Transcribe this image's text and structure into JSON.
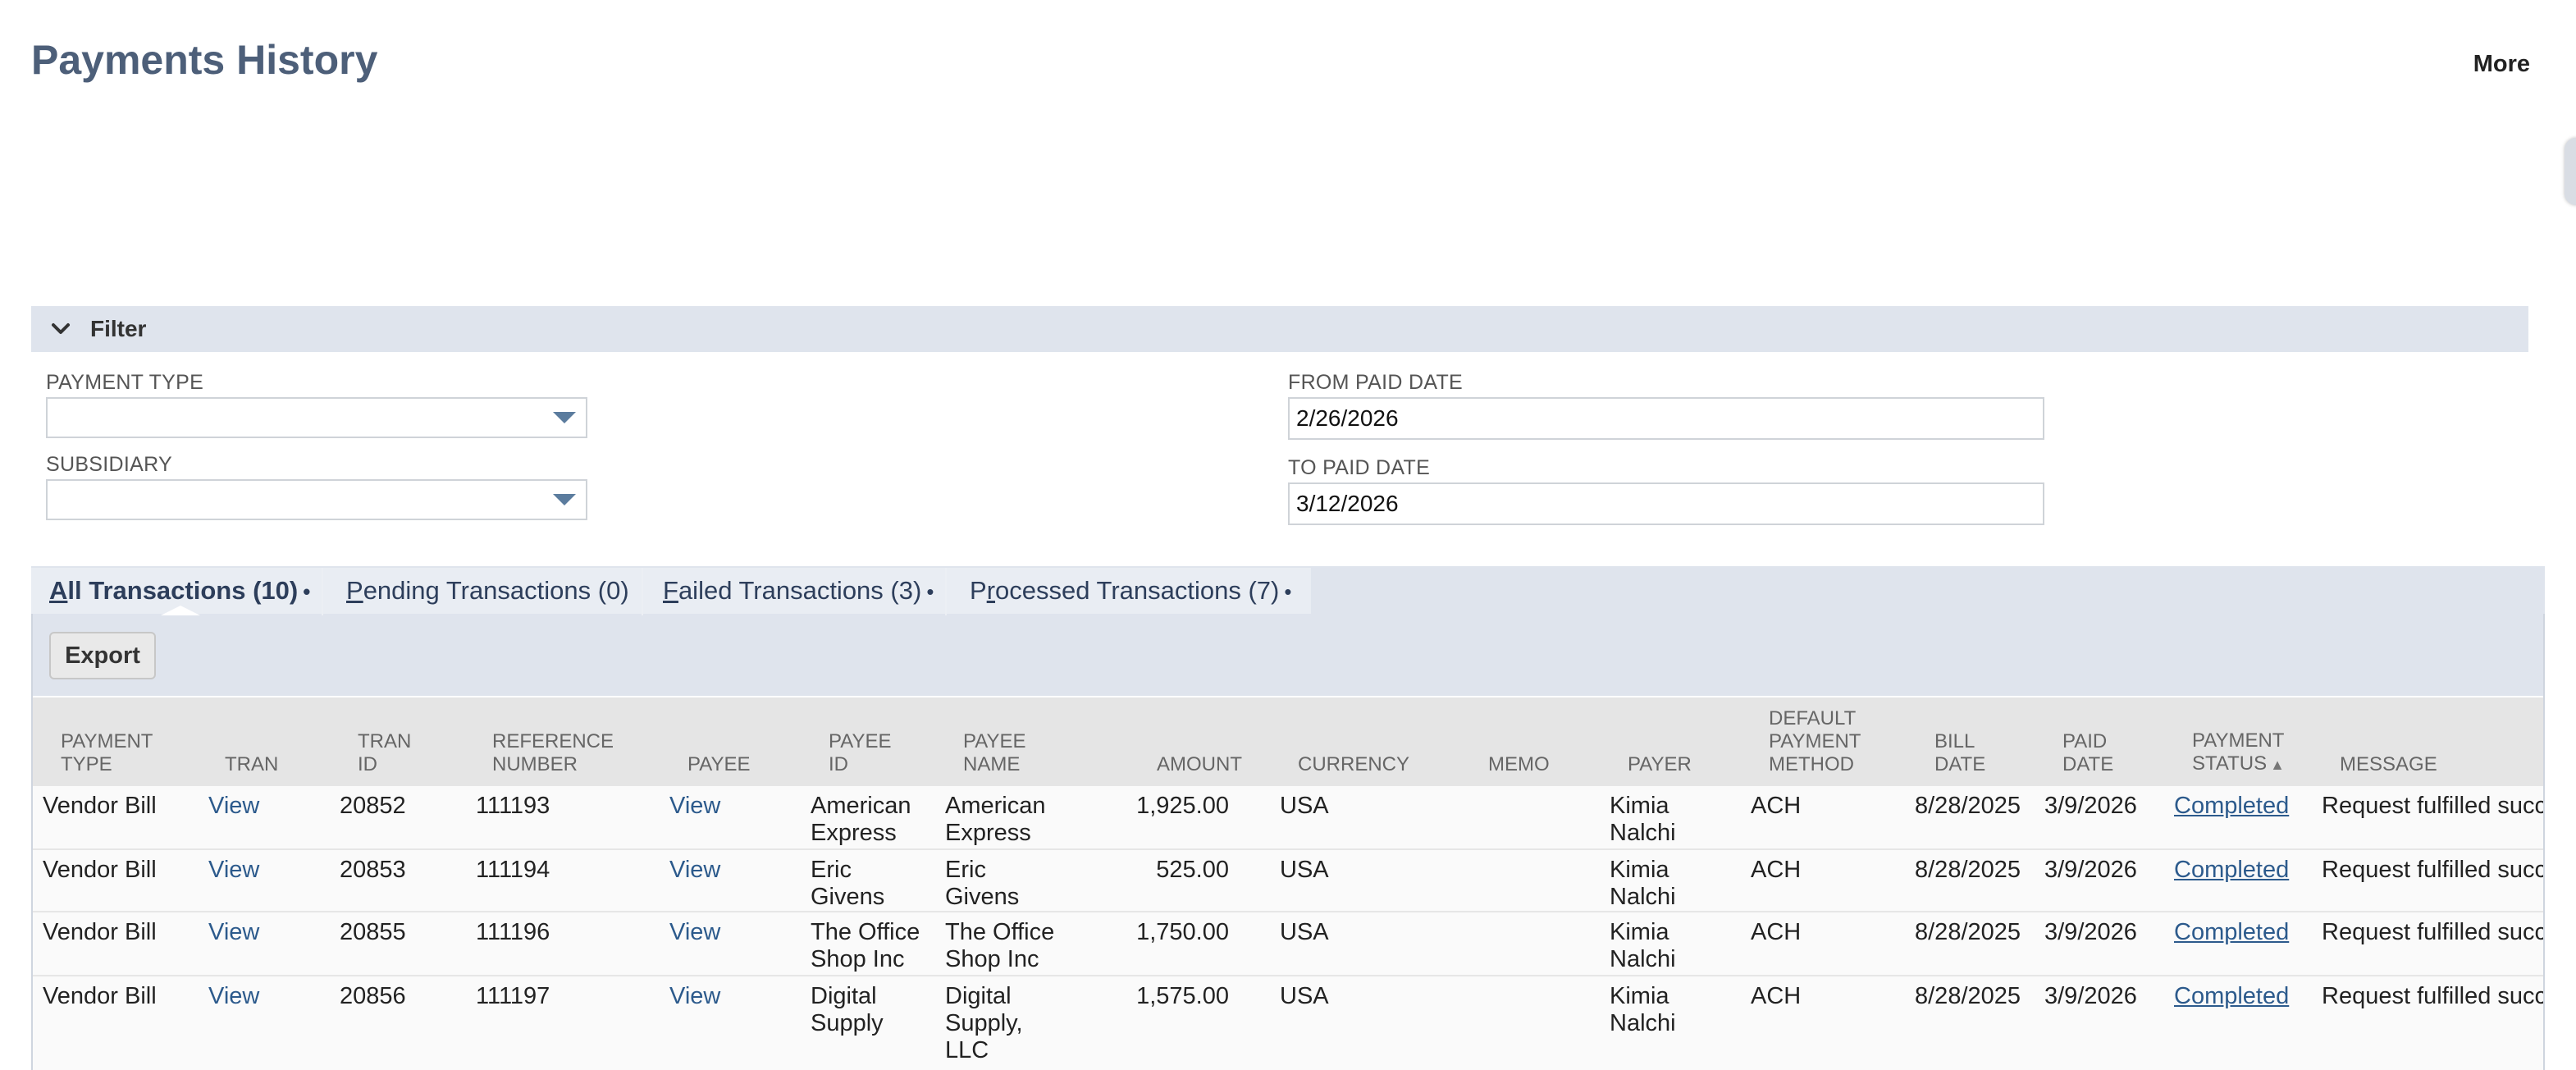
{
  "page": {
    "title": "Payments History",
    "more_label": "More"
  },
  "filter": {
    "label": "Filter",
    "payment_type_label": "PAYMENT TYPE",
    "payment_type_value": "",
    "subsidiary_label": "SUBSIDIARY",
    "subsidiary_value": "",
    "from_paid_date_label": "FROM PAID DATE",
    "from_paid_date_value": "2/26/2026",
    "to_paid_date_label": "TO PAID DATE",
    "to_paid_date_value": "3/12/2026"
  },
  "tabs": [
    {
      "first": "A",
      "rest": "ll Transactions (10)",
      "active": true,
      "dot": "•"
    },
    {
      "first": "P",
      "rest": "ending Transactions (0)",
      "active": false,
      "dot": ""
    },
    {
      "first": "F",
      "rest": "ailed Transactions (3)",
      "active": false,
      "dot": "•"
    },
    {
      "pre": "P",
      "first": "r",
      "rest": "ocessed Transactions (7)",
      "active": false,
      "dot": "•"
    }
  ],
  "export_label": "Export",
  "table": {
    "columns": [
      "PAYMENT\nTYPE",
      "TRAN",
      "TRAN\nID",
      "REFERENCE\nNUMBER",
      "PAYEE",
      "PAYEE\nID",
      "PAYEE\nNAME",
      "AMOUNT",
      "CURRENCY",
      "MEMO",
      "PAYER",
      "DEFAULT\nPAYMENT\nMETHOD",
      "BILL\nDATE",
      "PAID\nDATE",
      "PAYMENT\nSTATUS",
      "MESSAGE"
    ],
    "sort_indicator": "▲",
    "rows": [
      {
        "payment_type": "Vendor Bill",
        "tran": "View",
        "tran_id": "20852",
        "reference_number": "111193",
        "payee": "View",
        "payee_id": "American\nExpress",
        "payee_name": "American\nExpress",
        "amount": "1,925.00",
        "currency": "USA",
        "memo": "",
        "payer": "Kimia\nNalchi",
        "default_payment_method": "ACH",
        "bill_date": "8/28/2025",
        "paid_date": "3/9/2026",
        "payment_status": "Completed",
        "message": "Request fulfilled succ"
      },
      {
        "payment_type": "Vendor Bill",
        "tran": "View",
        "tran_id": "20853",
        "reference_number": "111194",
        "payee": "View",
        "payee_id": "Eric\nGivens",
        "payee_name": "Eric\nGivens",
        "amount": "525.00",
        "currency": "USA",
        "memo": "",
        "payer": "Kimia\nNalchi",
        "default_payment_method": "ACH",
        "bill_date": "8/28/2025",
        "paid_date": "3/9/2026",
        "payment_status": "Completed",
        "message": "Request fulfilled succ"
      },
      {
        "payment_type": "Vendor Bill",
        "tran": "View",
        "tran_id": "20855",
        "reference_number": "111196",
        "payee": "View",
        "payee_id": "The Office\nShop Inc",
        "payee_name": "The Office\nShop Inc",
        "amount": "1,750.00",
        "currency": "USA",
        "memo": "",
        "payer": "Kimia\nNalchi",
        "default_payment_method": "ACH",
        "bill_date": "8/28/2025",
        "paid_date": "3/9/2026",
        "payment_status": "Completed",
        "message": "Request fulfilled succ"
      },
      {
        "payment_type": "Vendor Bill",
        "tran": "View",
        "tran_id": "20856",
        "reference_number": "111197",
        "payee": "View",
        "payee_id": "Digital\nSupply",
        "payee_name": "Digital\nSupply,\nLLC",
        "amount": "1,575.00",
        "currency": "USA",
        "memo": "",
        "payer": "Kimia\nNalchi",
        "default_payment_method": "ACH",
        "bill_date": "8/28/2025",
        "paid_date": "3/9/2026",
        "payment_status": "Completed",
        "message": "Request fulfilled succ"
      }
    ]
  }
}
